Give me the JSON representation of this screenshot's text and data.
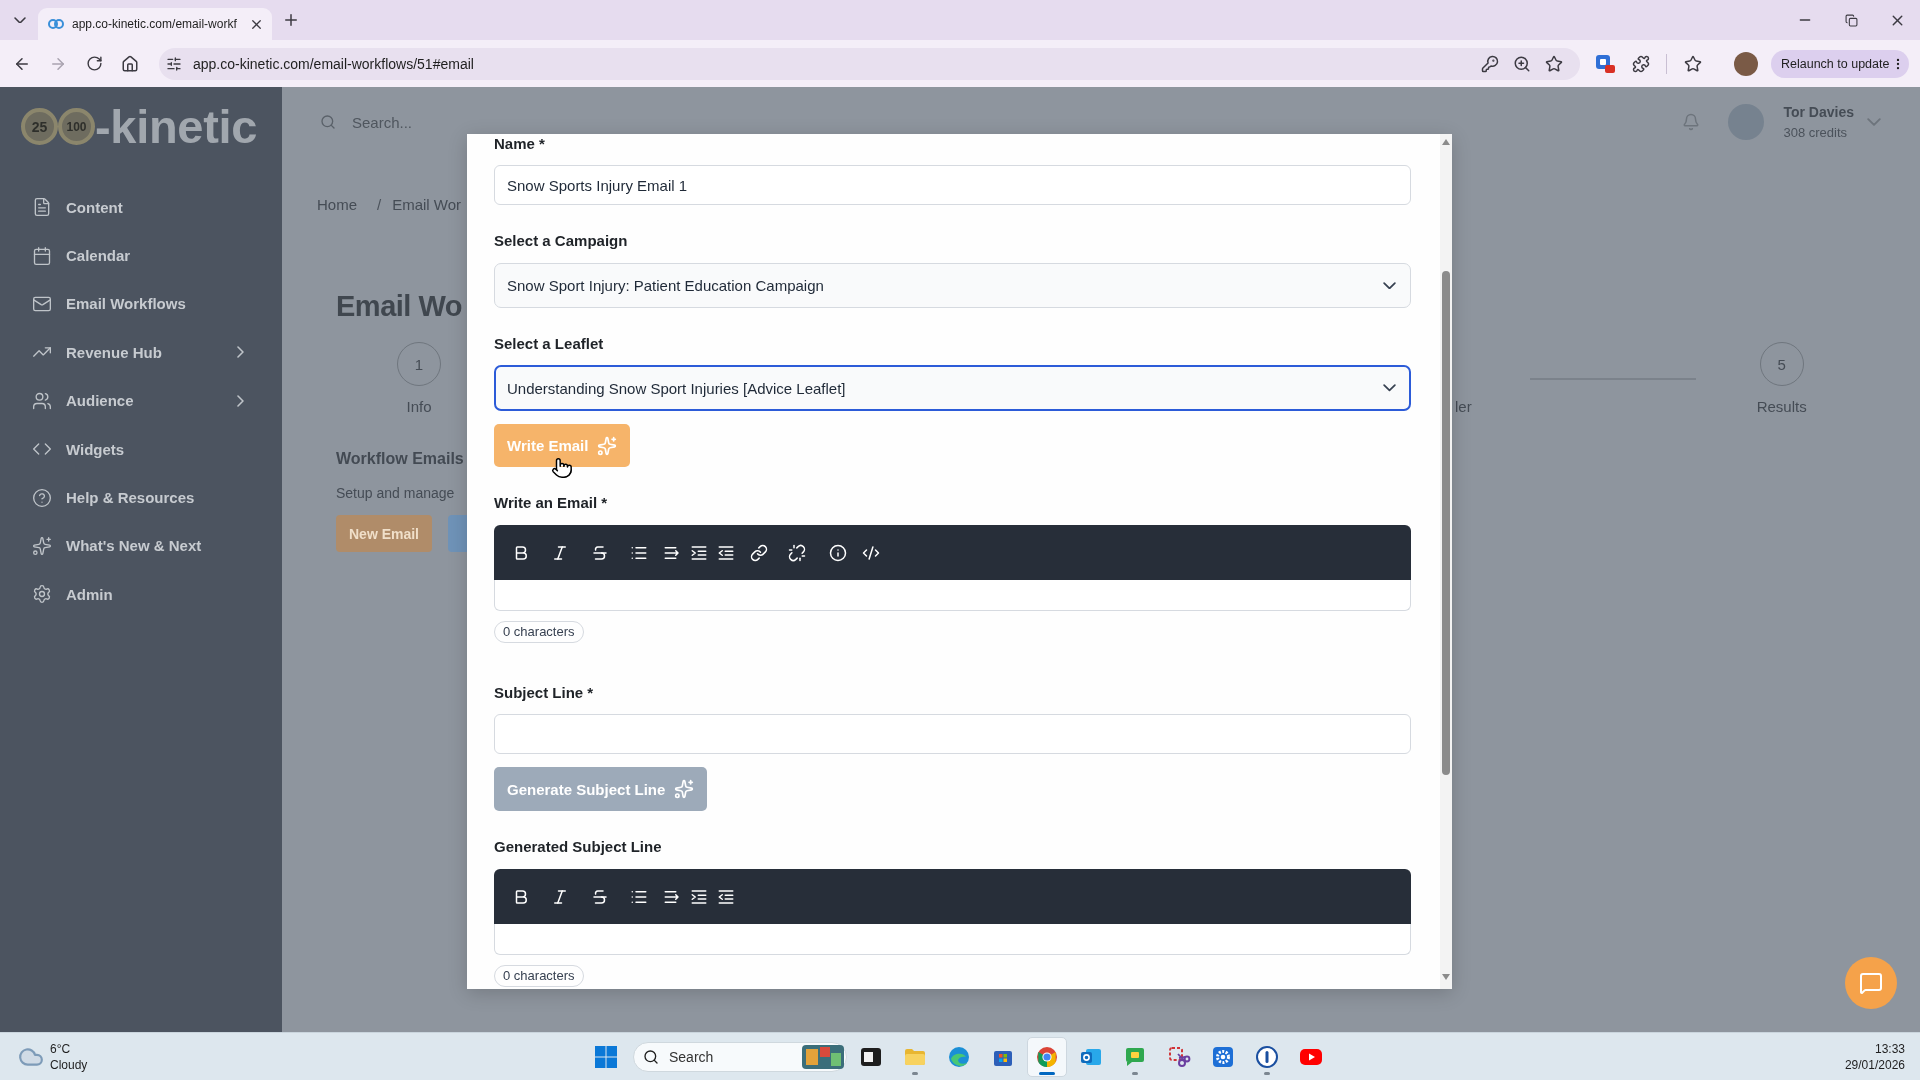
{
  "browser": {
    "tab": {
      "title": "app.co-kinetic.com/email-workf",
      "selected": true
    },
    "url": "app.co-kinetic.com/email-workflows/51#email",
    "relaunch_button": "Relaunch to update"
  },
  "app": {
    "logo": {
      "badge_1": "25",
      "badge_2": "100",
      "wordmark": "-kinetic"
    },
    "sidebar": {
      "items": [
        {
          "label": "Content",
          "has_submenu": false
        },
        {
          "label": "Calendar",
          "has_submenu": false
        },
        {
          "label": "Email Workflows",
          "has_submenu": false
        },
        {
          "label": "Revenue Hub",
          "has_submenu": true
        },
        {
          "label": "Audience",
          "has_submenu": true
        },
        {
          "label": "Widgets",
          "has_submenu": false
        },
        {
          "label": "Help & Resources",
          "has_submenu": false
        },
        {
          "label": "What's New & Next",
          "has_submenu": false
        },
        {
          "label": "Admin",
          "has_submenu": false
        }
      ]
    },
    "header": {
      "search": {
        "placeholder": "Search..."
      },
      "user": {
        "name": "Tor Davies",
        "credits": "308 credits"
      }
    },
    "breadcrumb": {
      "items": [
        "Home",
        "Email Wor"
      ],
      "separator": "/"
    },
    "page_title": "Email Wo",
    "steps": [
      {
        "number": "1",
        "label": "Info"
      },
      {
        "label": "ler"
      },
      {
        "number": "5",
        "label": "Results"
      }
    ],
    "section": {
      "title": "Workflow Emails",
      "subtitle": "Setup and manage",
      "button": "New Email"
    }
  },
  "modal": {
    "fields": [
      {
        "kind": "text",
        "label": "Name *",
        "value": "Snow Sports Injury Email 1"
      },
      {
        "kind": "select",
        "label": "Select a Campaign",
        "value": "Snow Sport Injury: Patient Education Campaign",
        "focused": false
      },
      {
        "kind": "select",
        "label": "Select a Leaflet",
        "value": "Understanding Snow Sport Injuries [Advice Leaflet]",
        "focused": true
      },
      {
        "kind": "button",
        "label": "Write Email",
        "disabled": false
      },
      {
        "kind": "editor",
        "label": "Write an Email *",
        "toolbar": {
          "kind": "full"
        },
        "counter": "0 characters"
      },
      {
        "kind": "text",
        "label": "Subject Line *"
      },
      {
        "kind": "button",
        "label": "Generate Subject Line",
        "disabled": true
      },
      {
        "kind": "editor",
        "label": "Generated Subject Line",
        "toolbar": {
          "kind": "basic"
        },
        "counter": "0 characters"
      }
    ]
  },
  "taskbar": {
    "weather": {
      "temperature": "6°C",
      "condition": "Cloudy"
    },
    "search": {
      "placeholder": "Search"
    },
    "apps": [
      {
        "kind": "window",
        "running": false,
        "active": false
      },
      {
        "kind": "folder",
        "running": true,
        "active": false
      },
      {
        "kind": "swirl",
        "running": false,
        "active": false
      },
      {
        "kind": "bag",
        "running": false,
        "active": false
      },
      {
        "kind": "wheel",
        "running": true,
        "active": true
      },
      {
        "kind": "envelope",
        "running": false,
        "active": false
      },
      {
        "kind": "chat",
        "running": true,
        "active": false
      },
      {
        "kind": "scissors",
        "running": false,
        "active": false
      },
      {
        "kind": "gear",
        "running": false,
        "active": false
      },
      {
        "kind": "keyhole",
        "running": true,
        "active": false
      },
      {
        "kind": "play",
        "running": false,
        "active": false
      }
    ],
    "clock": {
      "time": "13:33",
      "date": "29/01/2026"
    }
  }
}
